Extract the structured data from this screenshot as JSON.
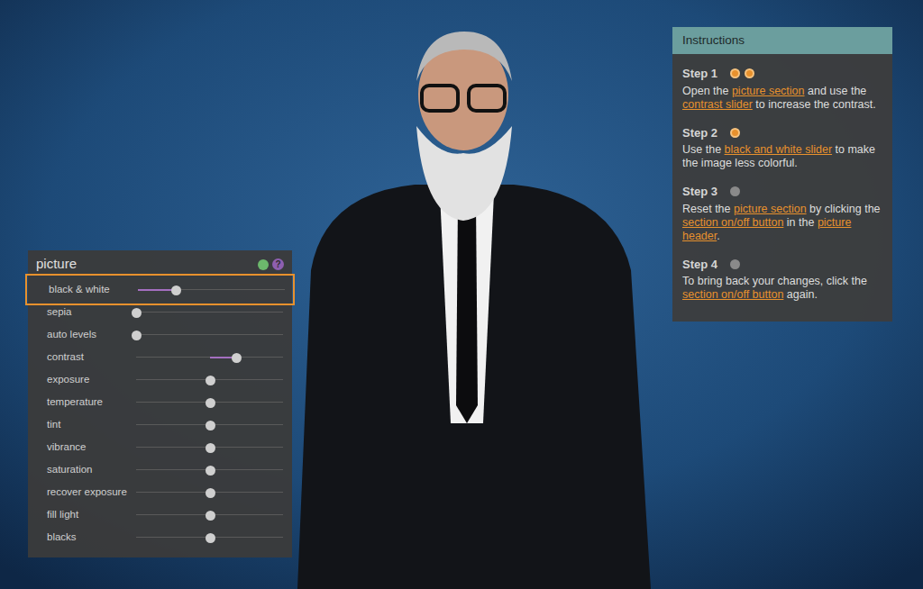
{
  "picture_panel": {
    "title": "picture",
    "enabled": true,
    "help": "?",
    "sliders": [
      {
        "label": "black & white",
        "kind": "one-sided",
        "level": 0.26,
        "highlighted": true
      },
      {
        "label": "sepia",
        "kind": "one-sided",
        "level": 0,
        "highlighted": false
      },
      {
        "label": "auto levels",
        "kind": "one-sided",
        "level": 0,
        "highlighted": false
      },
      {
        "label": "contrast",
        "kind": "centered",
        "level": 0.68,
        "highlighted": false
      },
      {
        "label": "exposure",
        "kind": "centered",
        "level": 0.5,
        "highlighted": false
      },
      {
        "label": "temperature",
        "kind": "centered",
        "level": 0.5,
        "highlighted": false
      },
      {
        "label": "tint",
        "kind": "centered",
        "level": 0.5,
        "highlighted": false
      },
      {
        "label": "vibrance",
        "kind": "centered",
        "level": 0.5,
        "highlighted": false
      },
      {
        "label": "saturation",
        "kind": "centered",
        "level": 0.5,
        "highlighted": false
      },
      {
        "label": "recover exposure",
        "kind": "centered",
        "level": 0.5,
        "highlighted": false
      },
      {
        "label": "fill light",
        "kind": "centered",
        "level": 0.5,
        "highlighted": false
      },
      {
        "label": "blacks",
        "kind": "centered",
        "level": 0.5,
        "highlighted": false
      }
    ]
  },
  "instructions": {
    "title": "Instructions",
    "steps": [
      {
        "label": "Step 1",
        "dots": [
          true,
          true
        ],
        "parts": [
          {
            "text": "Open the ",
            "link": false
          },
          {
            "text": "picture section",
            "link": true
          },
          {
            "text": " and use the ",
            "link": false
          },
          {
            "text": "contrast slider",
            "link": true
          },
          {
            "text": " to increase the contrast.",
            "link": false
          }
        ]
      },
      {
        "label": "Step 2",
        "dots": [
          true
        ],
        "parts": [
          {
            "text": "Use the ",
            "link": false
          },
          {
            "text": "black and white slider",
            "link": true
          },
          {
            "text": " to make the image less colorful.",
            "link": false
          }
        ]
      },
      {
        "label": "Step 3",
        "dots": [
          false
        ],
        "parts": [
          {
            "text": "Reset the ",
            "link": false
          },
          {
            "text": "picture section",
            "link": true
          },
          {
            "text": " by clicking the ",
            "link": false
          },
          {
            "text": "section on/off button",
            "link": true
          },
          {
            "text": " in the ",
            "link": false
          },
          {
            "text": "picture header",
            "link": true
          },
          {
            "text": ".",
            "link": false
          }
        ]
      },
      {
        "label": "Step 4",
        "dots": [
          false
        ],
        "parts": [
          {
            "text": "To bring back your changes, click the ",
            "link": false
          },
          {
            "text": "section on/off button",
            "link": true
          },
          {
            "text": " again.",
            "link": false
          }
        ]
      }
    ]
  }
}
